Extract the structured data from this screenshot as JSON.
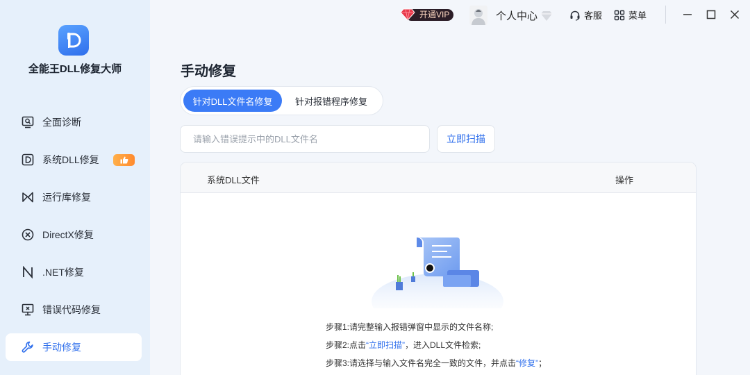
{
  "app": {
    "name": "全能王DLL修复大师"
  },
  "sidebar": {
    "items": [
      {
        "label": "全面诊断",
        "icon": "monitor-search-icon"
      },
      {
        "label": "系统DLL修复",
        "icon": "d-letter-icon",
        "badge": "thumbs-up-icon"
      },
      {
        "label": "运行库修复",
        "icon": "bowtie-icon"
      },
      {
        "label": "DirectX修复",
        "icon": "circle-x-icon"
      },
      {
        "label": ".NET修复",
        "icon": "n-letter-icon"
      },
      {
        "label": "错误代码修复",
        "icon": "monitor-x-icon"
      },
      {
        "label": "手动修复",
        "icon": "wrench-icon",
        "active": true
      }
    ]
  },
  "header": {
    "vip_label": "开通VIP",
    "user_center": "个人中心",
    "service": "客服",
    "menu": "菜单"
  },
  "main": {
    "title": "手动修复",
    "tabs": [
      {
        "label": "针对DLL文件名修复",
        "active": true
      },
      {
        "label": "针对报错程序修复",
        "active": false
      }
    ],
    "search": {
      "placeholder": "请输入错误提示中的DLL文件名",
      "value": ""
    },
    "scan_button": "立即扫描",
    "table": {
      "columns": [
        "系统DLL文件",
        "操作"
      ]
    },
    "steps": {
      "step1": "步骤1:请完整输入报错弹窗中显示的文件名称;",
      "step2_prefix": "步骤2:点击",
      "step2_link": "“立即扫描”",
      "step2_suffix": "，进入DLL文件检索;",
      "step3_prefix": "步骤3:请选择与输入文件名完全一致的文件，并点击",
      "step3_link": "“修复”",
      "step3_suffix": "；"
    }
  },
  "colors": {
    "accent": "#3b7bf6",
    "sidebar_bg": "#e6f0fb",
    "vip_bg": "#2b1d27",
    "badge": "#ff8a2e"
  }
}
